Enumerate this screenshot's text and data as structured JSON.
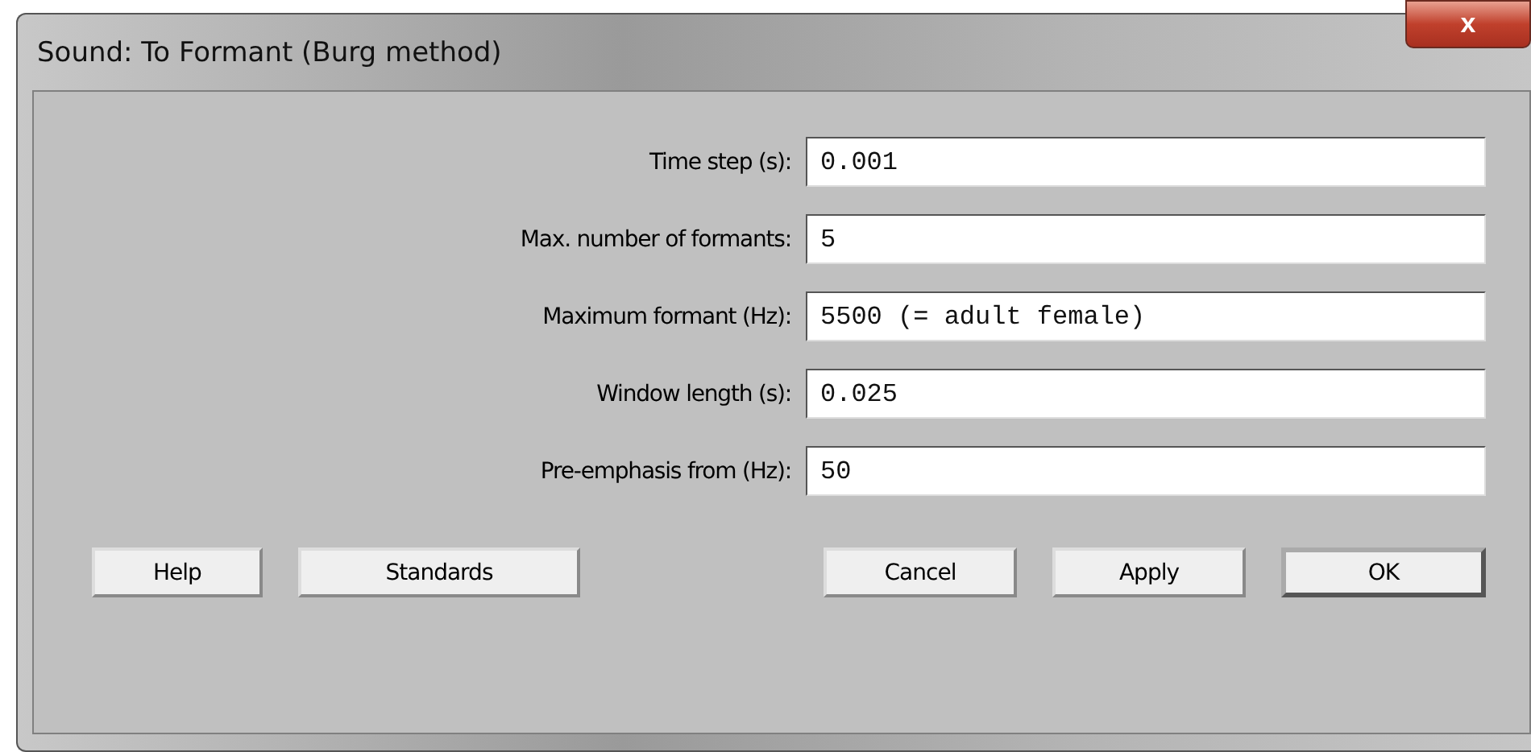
{
  "window": {
    "title": "Sound: To Formant (Burg method)",
    "close_label": "x"
  },
  "fields": [
    {
      "label": "Time step (s):",
      "value": "0.001"
    },
    {
      "label": "Max. number of formants:",
      "value": "5"
    },
    {
      "label": "Maximum formant (Hz):",
      "value": "5500 (= adult female)"
    },
    {
      "label": "Window length (s):",
      "value": "0.025"
    },
    {
      "label": "Pre-emphasis from (Hz):",
      "value": "50"
    }
  ],
  "buttons_left": [
    {
      "label": "Help",
      "default": false
    },
    {
      "label": "Standards",
      "default": false
    }
  ],
  "buttons_right": [
    {
      "label": "Cancel",
      "default": false
    },
    {
      "label": "Apply",
      "default": false
    },
    {
      "label": "OK",
      "default": true
    }
  ]
}
